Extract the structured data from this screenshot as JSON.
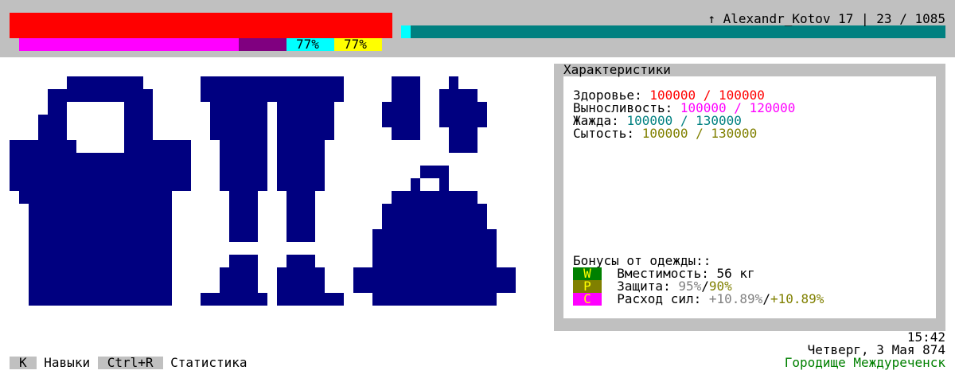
{
  "status_bars": {
    "health_color": "#ff0000",
    "stamina_color": "#ff00ff",
    "stamina_missing_color": "#800080",
    "thirst_percent": "77%",
    "satiety_percent": "77%",
    "xp_color": "#008080"
  },
  "player": {
    "line": "↑ Alexandr_Kotov 17 | 23 / 1085"
  },
  "equipment": {
    "icons": [
      "shirt-icon",
      "pants-icon",
      "boots-icon",
      "gloves-icon",
      "bag-icon"
    ],
    "icon_color": "#000080"
  },
  "stats": {
    "title": "Характеристики",
    "health_label": "Здоровье:",
    "health_value": "100000 / 100000",
    "stamina_label": "Выносливость:",
    "stamina_value": "100000 / 120000",
    "thirst_label": "Жажда:",
    "thirst_value": "100000 / 130000",
    "satiety_label": "Сытость:",
    "satiety_value": "100000 / 130000",
    "bonuses_title": "Бонусы от одежды::",
    "bonuses": [
      {
        "badge": "W",
        "label": "Вместимость:",
        "value": "56 кг"
      },
      {
        "badge": "P",
        "label": "Защита:",
        "value_a": "95%",
        "sep": "/",
        "value_b": "90%"
      },
      {
        "badge": "C",
        "label": "Расход сил:",
        "value_a": "+10.89%",
        "sep": "/",
        "value_b": "+10.89%"
      }
    ]
  },
  "hotkeys": [
    {
      "key": "K",
      "label": "Навыки"
    },
    {
      "key": "Ctrl+R",
      "label": "Статистика"
    }
  ],
  "world": {
    "time": "15:42",
    "date": "Четверг, 3 Мая 874",
    "location": "Городище Междуреченск"
  }
}
